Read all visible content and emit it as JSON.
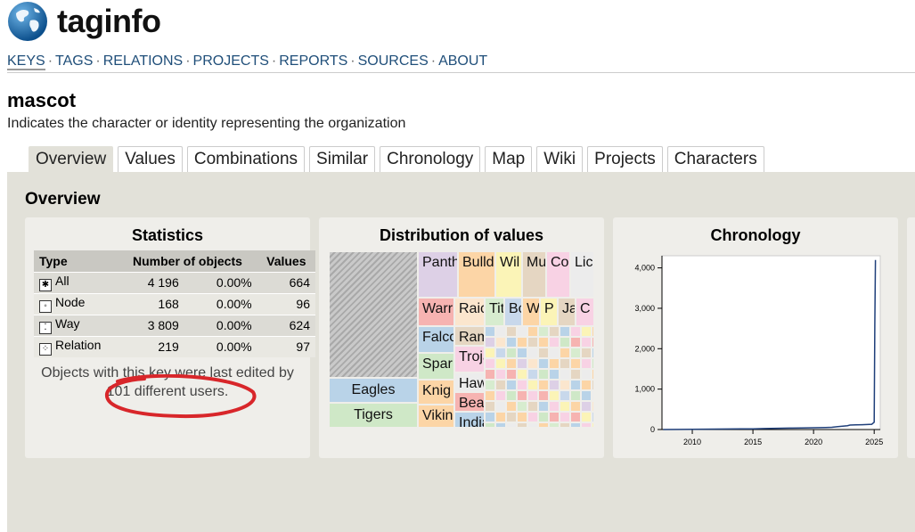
{
  "app": {
    "name": "taginfo"
  },
  "nav": {
    "items": [
      "KEYS",
      "TAGS",
      "RELATIONS",
      "PROJECTS",
      "REPORTS",
      "SOURCES",
      "ABOUT"
    ],
    "separator": "·"
  },
  "key": {
    "name": "mascot",
    "description": "Indicates the character or identity representing the organization"
  },
  "tabs": [
    "Overview",
    "Values",
    "Combinations",
    "Similar",
    "Chronology",
    "Map",
    "Wiki",
    "Projects",
    "Characters"
  ],
  "overview": {
    "title": "Overview",
    "statistics": {
      "title": "Statistics",
      "headers": {
        "type": "Type",
        "objects": "Number of objects",
        "values": "Values"
      },
      "rows": [
        {
          "type": "All",
          "icon": "all-icon",
          "count": "4 196",
          "percent": "0.00%",
          "values": "664"
        },
        {
          "type": "Node",
          "icon": "node-icon",
          "count": "168",
          "percent": "0.00%",
          "values": "96"
        },
        {
          "type": "Way",
          "icon": "way-icon",
          "count": "3 809",
          "percent": "0.00%",
          "values": "624"
        },
        {
          "type": "Relation",
          "icon": "relation-icon",
          "count": "219",
          "percent": "0.00%",
          "values": "97"
        }
      ],
      "note_line1": "Objects with this key were last edited by",
      "note_line2": "101 different users.",
      "annotation_color": "#d8262a"
    },
    "distribution": {
      "title": "Distribution of values",
      "cells": [
        {
          "label": "Eagles",
          "color": "#b9d3e8"
        },
        {
          "label": "Tigers",
          "color": "#cfe8c7"
        },
        {
          "label": "Panth",
          "color": "#ddd0e6"
        },
        {
          "label": "Bulld",
          "color": "#fcd5a6"
        },
        {
          "label": "Wil",
          "color": "#fbf4b7"
        },
        {
          "label": "Mu",
          "color": "#e5d6c2"
        },
        {
          "label": "Co",
          "color": "#f8d2e4"
        },
        {
          "label": "Lic",
          "color": "#ececec"
        },
        {
          "label": "Warr",
          "color": "#f6b3b1"
        },
        {
          "label": "Raic",
          "color": "#fbe6ce"
        },
        {
          "label": "Tit",
          "color": "#d7eccf"
        },
        {
          "label": "Bc",
          "color": "#c8d8eb"
        },
        {
          "label": "W",
          "color": "#fcd5a6"
        },
        {
          "label": "P",
          "color": "#fbf4b7"
        },
        {
          "label": "Ja",
          "color": "#e5d6c2"
        },
        {
          "label": "C",
          "color": "#f8d2e4"
        },
        {
          "label": "Falco",
          "color": "#b9d3e8"
        },
        {
          "label": "Ram",
          "color": "#e5d6c2"
        },
        {
          "label": "Spar",
          "color": "#cfe8c7"
        },
        {
          "label": "Troja",
          "color": "#f8d2e4"
        },
        {
          "label": "Knig",
          "color": "#fcd5a6"
        },
        {
          "label": "Haw",
          "color": "#ececec"
        },
        {
          "label": "Bear",
          "color": "#f6b3b1"
        },
        {
          "label": "Vikin",
          "color": "#fcd5a6"
        },
        {
          "label": "India",
          "color": "#b9d3e8"
        }
      ]
    },
    "chronology": {
      "title": "Chronology",
      "line_color": "#1f3f7a"
    }
  },
  "chart_data": {
    "type": "line",
    "title": "Chronology",
    "xlabel": "",
    "ylabel": "",
    "x_ticks": [
      "2010",
      "2015",
      "2020",
      "2025"
    ],
    "y_ticks": [
      "0",
      "1,000",
      "2,000",
      "3,000",
      "4,000"
    ],
    "xlim": [
      2007.5,
      2025.5
    ],
    "ylim": [
      0,
      4300
    ],
    "series": [
      {
        "x": [
          2007.6,
          2010,
          2012,
          2014,
          2015,
          2016,
          2017,
          2018,
          2019,
          2020,
          2021,
          2021.5,
          2022,
          2022.8,
          2023,
          2023.5,
          2024,
          2024.8,
          2025.0,
          2025.05,
          2025.1
        ],
        "y": [
          0,
          5,
          10,
          15,
          18,
          25,
          30,
          35,
          40,
          45,
          50,
          55,
          70,
          95,
          110,
          115,
          120,
          130,
          180,
          2600,
          4196
        ]
      }
    ],
    "grid": false
  }
}
